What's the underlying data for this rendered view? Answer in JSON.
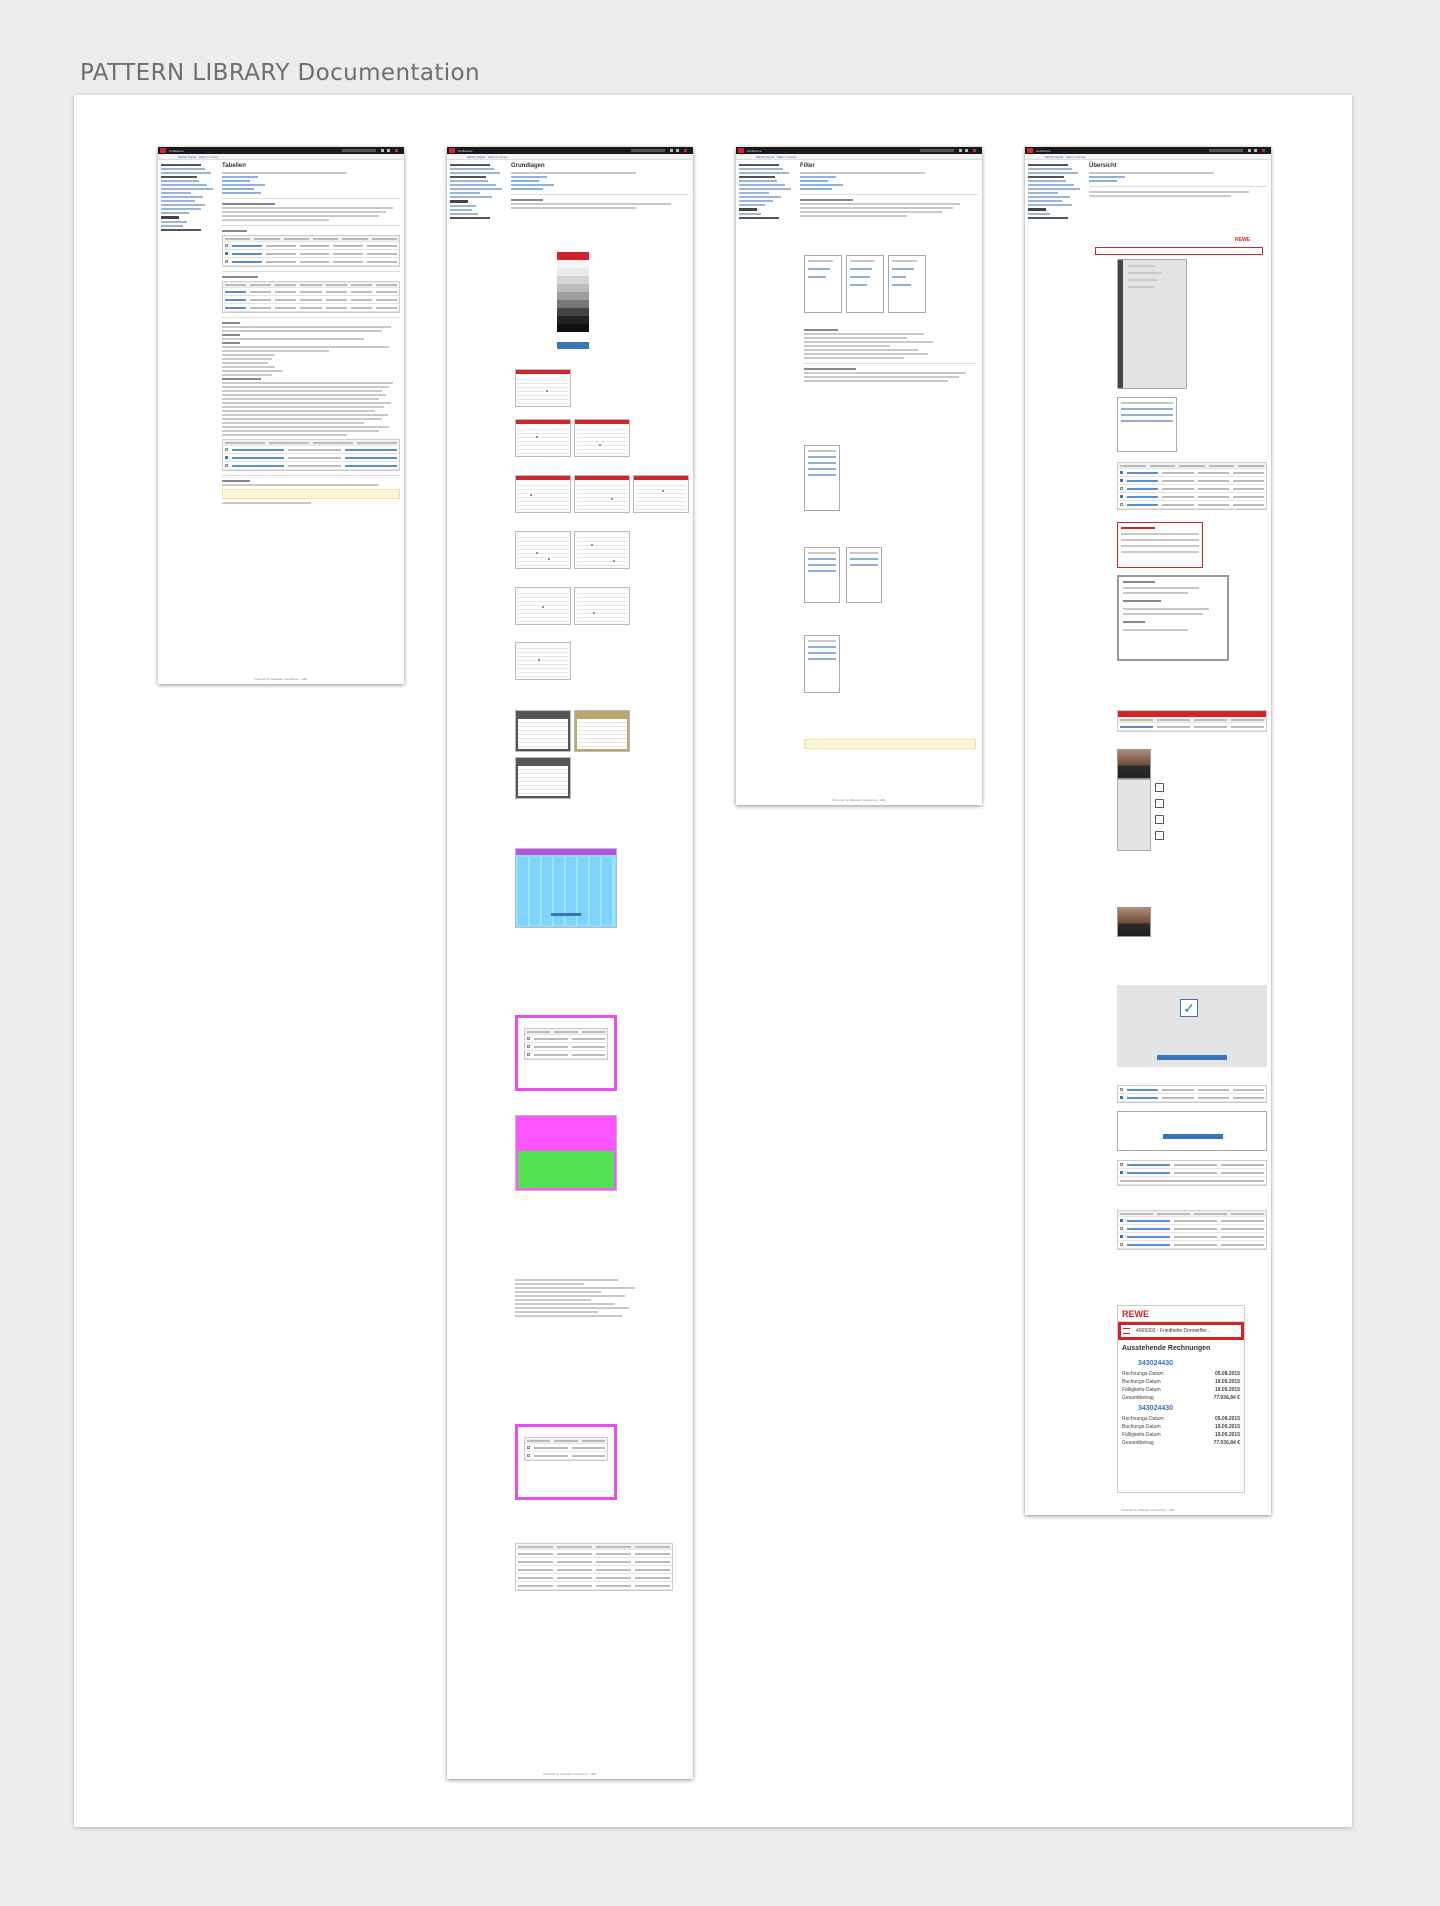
{
  "page": {
    "title": "PATTERN LIBRARY Documentation"
  },
  "thumbs": {
    "t1": {
      "topbar": "confluence",
      "breadcrumb": "REWE Digital · Pattern Library",
      "title": "Tabellen",
      "footer": "Powered by Atlassian Confluence · Hilfe"
    },
    "t2": {
      "topbar": "confluence",
      "breadcrumb": "REWE Digital · Pattern Library",
      "title": "Grundlagen",
      "footer": "Powered by Atlassian Confluence · Hilfe"
    },
    "t3": {
      "topbar": "confluence",
      "breadcrumb": "REWE Digital · Pattern Library",
      "title": "Filter",
      "footer": "Powered by Atlassian Confluence · Hilfe"
    },
    "t4": {
      "topbar": "confluence",
      "breadcrumb": "REWE Digital · Pattern Library",
      "title": "Übersicht",
      "footer": "Powered by Atlassian Confluence · Hilfe",
      "rewe": {
        "logo": "REWE",
        "bar": "4065003 - Friedhelm Donnerfler...",
        "section": "Ausstehende Rechnungen",
        "item1_number": "343024430",
        "item2_number": "343024430",
        "rows1": [
          {
            "label": "Rechnungs-Datum",
            "value": "05.08.2015"
          },
          {
            "label": "Buchungs-Datum",
            "value": "19.09.2015"
          },
          {
            "label": "Fälligkeits-Datum",
            "value": "19.09.2015"
          },
          {
            "label": "Gesamtbetrag",
            "value": "77.036,84 €"
          }
        ],
        "rows2": [
          {
            "label": "Rechnungs-Datum",
            "value": "05.08.2015"
          },
          {
            "label": "Buchungs-Datum",
            "value": "19.09.2015"
          },
          {
            "label": "Fälligkeits-Datum",
            "value": "19.09.2015"
          },
          {
            "label": "Gesamtbetrag",
            "value": "77.036,84 €"
          }
        ]
      }
    }
  },
  "colors": {
    "rewe_red": "#d2232a",
    "link_blue": "#3b73b9",
    "board_bg": "#ffffff",
    "page_bg": "#ececec"
  }
}
